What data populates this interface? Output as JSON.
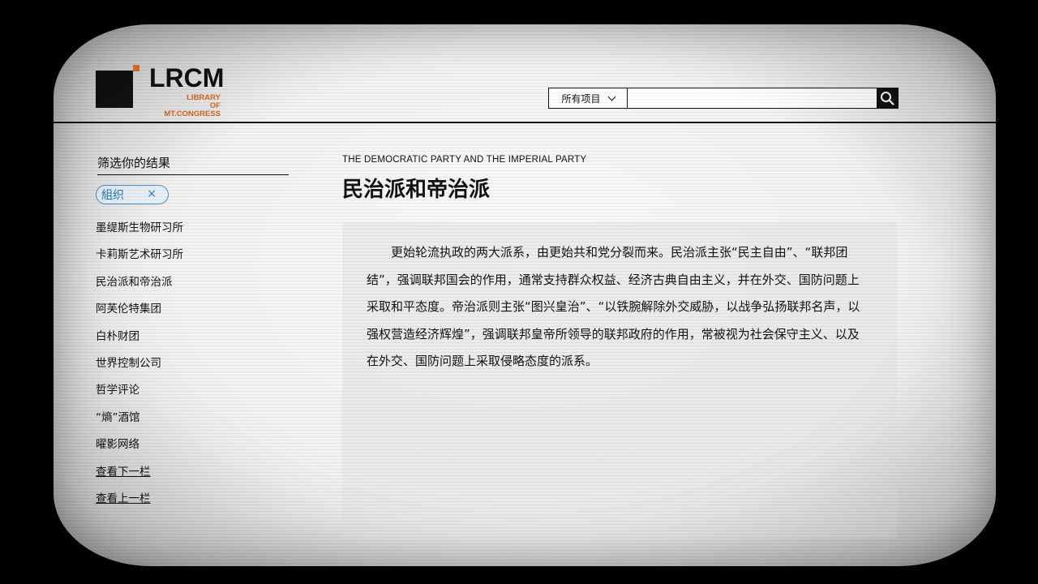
{
  "header": {
    "logo_text": "LRCM",
    "logo_sub_line1": "LIBRARY",
    "logo_sub_line2": "OF MT.CONGRESS",
    "search_scope": "所有项目",
    "search_placeholder": ""
  },
  "sidebar": {
    "title": "筛选你的结果",
    "chip": {
      "label": "組织",
      "close": "×"
    },
    "items": [
      {
        "label": "墨缇斯生物研习所"
      },
      {
        "label": "卡莉斯艺术研习所"
      },
      {
        "label": "民治派和帝治派"
      },
      {
        "label": "阿芙伦特集团"
      },
      {
        "label": "白朴财团"
      },
      {
        "label": "世界控制公司"
      },
      {
        "label": "哲学评论"
      },
      {
        "label": "“熵”酒馆"
      },
      {
        "label": "曜影网络"
      },
      {
        "label": "查看下一栏"
      },
      {
        "label": "查看上一栏"
      }
    ]
  },
  "article": {
    "subtitle_en": "THE DEMOCRATIC PARTY AND THE IMPERIAL PARTY",
    "title": "民治派和帝治派",
    "body": "更始轮流执政的两大派系，由更始共和党分裂而来。民治派主张“民主自由”、“联邦团结”，强调联邦国会的作用，通常支持群众权益、经济古典自由主义，并在外交、国防问题上采取和平态度。帝治派则主张“图兴皇治”、“以铁腕解除外交威胁，以战争弘扬联邦名声，以强权营造经济辉煌”，强调联邦皇帝所领导的联邦政府的作用，常被视为社会保守主义、以及在外交、国防问题上采取侵略态度的派系。"
  },
  "colors": {
    "accent": "#e3782a",
    "chip": "#2a7bb8"
  }
}
